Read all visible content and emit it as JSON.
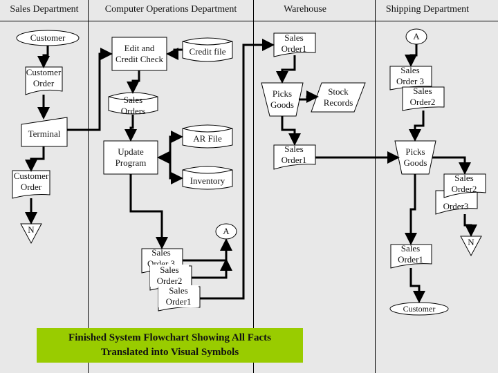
{
  "lanes": [
    {
      "label": "Sales Department"
    },
    {
      "label": "Computer Operations Department"
    },
    {
      "label": "Warehouse"
    },
    {
      "label": "Shipping Department"
    }
  ],
  "nodes": {
    "customer_top": "Customer",
    "customer_order_1": [
      "Customer",
      "Order"
    ],
    "terminal": "Terminal",
    "customer_order_2": [
      "Customer",
      "Order"
    ],
    "offpage_n_left": "N",
    "edit_credit": [
      "Edit and",
      "Credit Check"
    ],
    "credit_file": "Credit file",
    "sales_orders_db": [
      "Sales",
      "Orders"
    ],
    "update_program": [
      "Update",
      "Program"
    ],
    "ar_file": "AR File",
    "inventory": "Inventory",
    "connector_a_mid": "A",
    "stack_so3": [
      "Sales",
      "Order 3"
    ],
    "stack_so2": [
      "Sales",
      "Order2"
    ],
    "stack_so1": [
      "Sales",
      "Order1"
    ],
    "wh_sales_order1_top": [
      "Sales",
      "Order1"
    ],
    "wh_picks_goods": [
      "Picks",
      "Goods"
    ],
    "stock_records": [
      "Stock",
      "Records"
    ],
    "wh_sales_order1_bottom": [
      "Sales",
      "Order1"
    ],
    "connector_a_ship": "A",
    "ship_so3": [
      "Sales",
      "Order 3"
    ],
    "ship_so2_top": [
      "Sales",
      "Order2"
    ],
    "ship_picks_goods": [
      "Picks",
      "Goods"
    ],
    "ship_so2": [
      "Sales",
      "Order2"
    ],
    "ship_order3": "Order3",
    "offpage_n_right": "N",
    "ship_sales_order1": [
      "Sales",
      "Order1"
    ],
    "customer_bottom": "Customer"
  },
  "caption": [
    "Finished System Flowchart Showing All Facts",
    "Translated into Visual Symbols"
  ],
  "colors": {
    "caption_bg": "#99cc00",
    "background": "#e8e8e8"
  }
}
